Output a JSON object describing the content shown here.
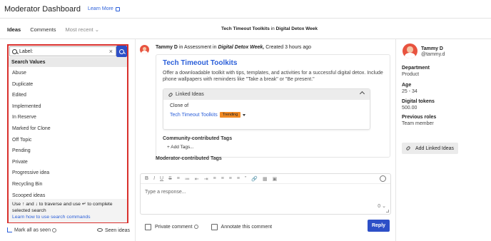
{
  "header": {
    "title": "Moderator Dashboard",
    "learn_more": "Learn More"
  },
  "subnav": {
    "tabs": [
      {
        "label": "Ideas"
      },
      {
        "label": "Comments"
      },
      {
        "label": "Most recent"
      }
    ],
    "center_title": "Tech Timeout Toolkits",
    "center_in": "in",
    "center_context": "Digital Detox Week"
  },
  "search": {
    "value": "Label:",
    "header": "Search Values",
    "options": [
      "Abuse",
      "Duplicate",
      "Edited",
      "Implemented",
      "In Reserve",
      "Marked for Clone",
      "Off Topic",
      "Pending",
      "Private",
      "Progressive idea",
      "Recycling Bin",
      "Scooped ideas"
    ],
    "hint": "Use ↑ and ↓ to traverse and use ↵ to complete selected search",
    "hint_link": "Learn how to use search commands"
  },
  "left_footer": {
    "mark_seen": "Mark all as seen",
    "seen_ideas": "Seen ideas"
  },
  "post": {
    "author": "Tammy D",
    "in_text": "in Assessment in",
    "campaign": "Digital Detox Week,",
    "created": "Created 3 hours ago",
    "idea_title": "Tech Timeout Toolkits",
    "description": "Offer a downloadable toolkit with tips, templates, and activities for a successful digital detox. Include phone wallpapers with reminders like \"Take a break\" or \"Be present.\"",
    "linked_ideas_label": "Linked Ideas",
    "clone_of": "Clone of",
    "clone_link": "Tech Timeout Toolkits",
    "badge": "Trending",
    "community_tags": "Community-contributed Tags",
    "add_tags": "+ Add Tags...",
    "moderator_tags": "Moderator-contributed Tags"
  },
  "editor": {
    "toolbar": [
      "B",
      "I",
      "U",
      "S",
      "≡",
      "≔",
      "⇤",
      "⇥",
      "≡",
      "≡",
      "≡",
      "≡",
      "”",
      "🔗",
      "▦",
      "▣"
    ],
    "placeholder": "Type a response...",
    "footer_icon": "0 ⌄"
  },
  "reply_bar": {
    "private_comment": "Private comment",
    "annotate": "Annotate this comment",
    "reply": "Reply"
  },
  "profile": {
    "name": "Tammy D",
    "handle": "@tammy.d",
    "fields": [
      {
        "k": "Department",
        "v": "Product"
      },
      {
        "k": "Age",
        "v": "25 - 34"
      },
      {
        "k": "Digital tokens",
        "v": "500.00"
      },
      {
        "k": "Previous roles",
        "v": "Team member"
      }
    ],
    "add_linked": "Add Linked Ideas"
  },
  "colors": {
    "accent": "#2d4fc7",
    "highlight": "#d9302c",
    "badge": "#f08a24",
    "avatar": "#e8533f"
  }
}
